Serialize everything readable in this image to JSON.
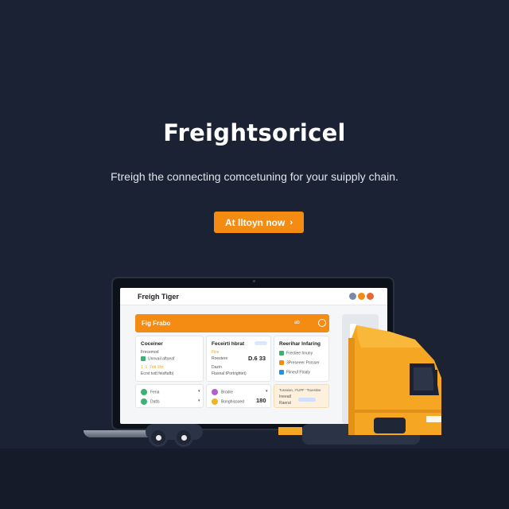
{
  "hero": {
    "title": "Freightsoricel",
    "subtitle": "Ftreigh the connecting comcetuning for your suipply chain.",
    "cta_label": "At lltoyn now",
    "cta_icon": "chevron-right-icon"
  },
  "app": {
    "name": "Freigh Tiger",
    "banner_title": "Fig Frabo",
    "banner_menu": "ab",
    "cards": {
      "c1": {
        "title": "Coceiner",
        "lines": [
          "Frecemod",
          "Unnvail aftoeaf",
          "1 :1 :7eti 1fct",
          "Ecrst tvdt feisftafb)"
        ]
      },
      "c2": {
        "title": "Feceirti hbrat",
        "lines": [
          "Fice",
          "Roestere",
          "Dazin",
          "Flasnal tPortrightet)"
        ],
        "value": "D.6 33"
      },
      "c3": {
        "title": "Reerihar Infaring",
        "lines": [
          "Frectiee hnuny",
          "3Preseeer Prosser",
          "Flineuf Ftoaly"
        ]
      },
      "c4": {
        "lines": [
          "Fena",
          "Datts"
        ]
      },
      "c5": {
        "lines": [
          "Brodre",
          "Bonghissoed"
        ],
        "value": "180"
      },
      "c6": {
        "lines": [
          "Tusvoian, :FLIPF ' Tcuestine",
          "Ineeatl",
          "Raeral"
        ]
      }
    }
  },
  "colors": {
    "background": "#1b2233",
    "accent": "#f48c13",
    "truck": "#f5a623"
  }
}
